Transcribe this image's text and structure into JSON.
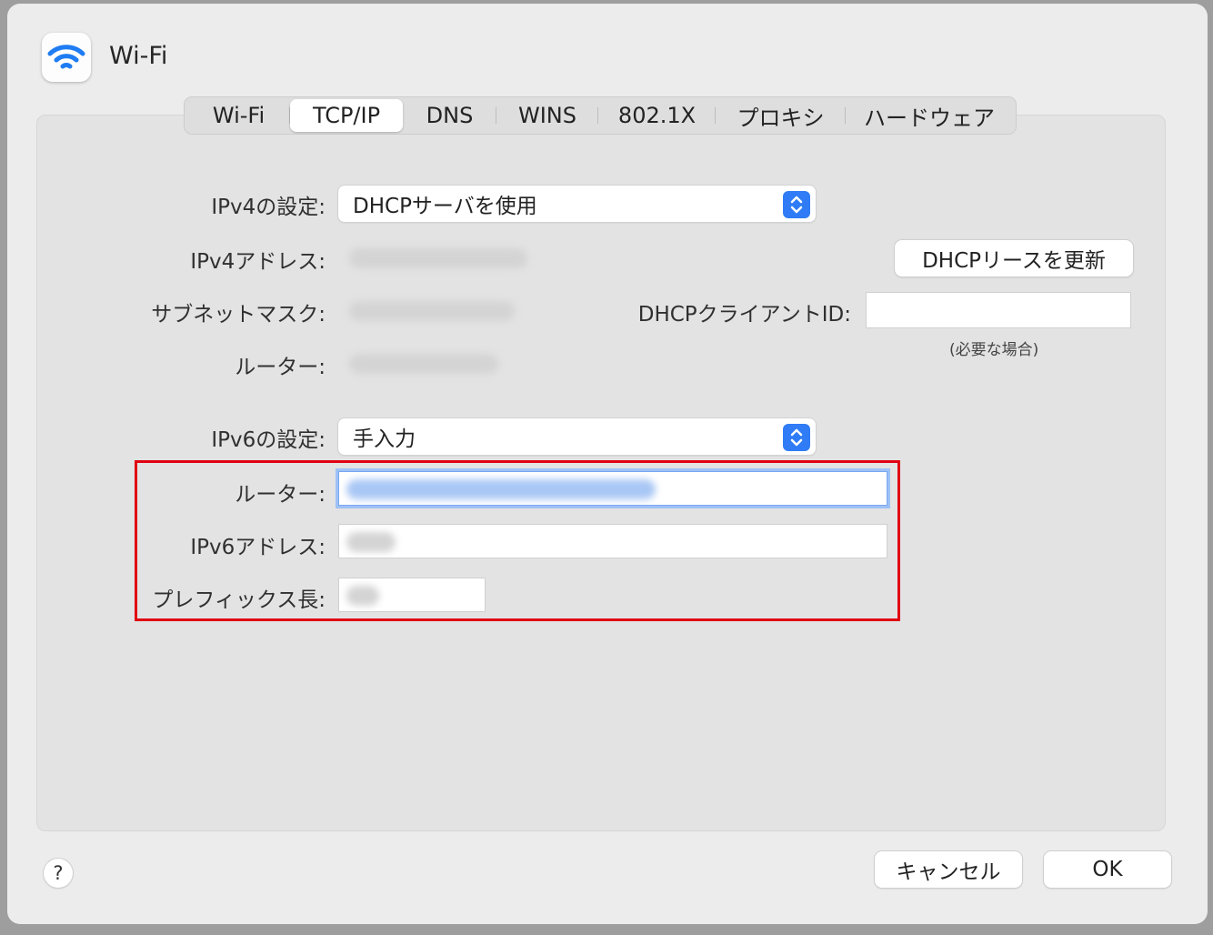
{
  "window": {
    "title": "Wi-Fi"
  },
  "tabs": [
    {
      "label": "Wi-Fi",
      "active": false
    },
    {
      "label": "TCP/IP",
      "active": true
    },
    {
      "label": "DNS",
      "active": false
    },
    {
      "label": "WINS",
      "active": false
    },
    {
      "label": "802.1X",
      "active": false
    },
    {
      "label": "プロキシ",
      "active": false
    },
    {
      "label": "ハードウェア",
      "active": false
    }
  ],
  "ipv4": {
    "config_label": "IPv4の設定:",
    "config_value": "DHCPサーバを使用",
    "address_label": "IPv4アドレス:",
    "subnet_label": "サブネットマスク:",
    "router_label": "ルーター:",
    "renew_button": "DHCPリースを更新",
    "client_id_label": "DHCPクライアントID:",
    "client_id_value": "",
    "client_id_hint": "(必要な場合)"
  },
  "ipv6": {
    "config_label": "IPv6の設定:",
    "config_value": "手入力",
    "router_label": "ルーター:",
    "address_label": "IPv6アドレス:",
    "prefix_label": "プレフィックス長:"
  },
  "footer": {
    "help": "?",
    "cancel": "キャンセル",
    "ok": "OK"
  },
  "colors": {
    "accent": "#2f7cf6",
    "highlight_box": "#e00012",
    "focus_ring": "#9ec1f7"
  },
  "icons": [
    "wifi-icon",
    "up-down-chevron-icon",
    "help-icon"
  ]
}
